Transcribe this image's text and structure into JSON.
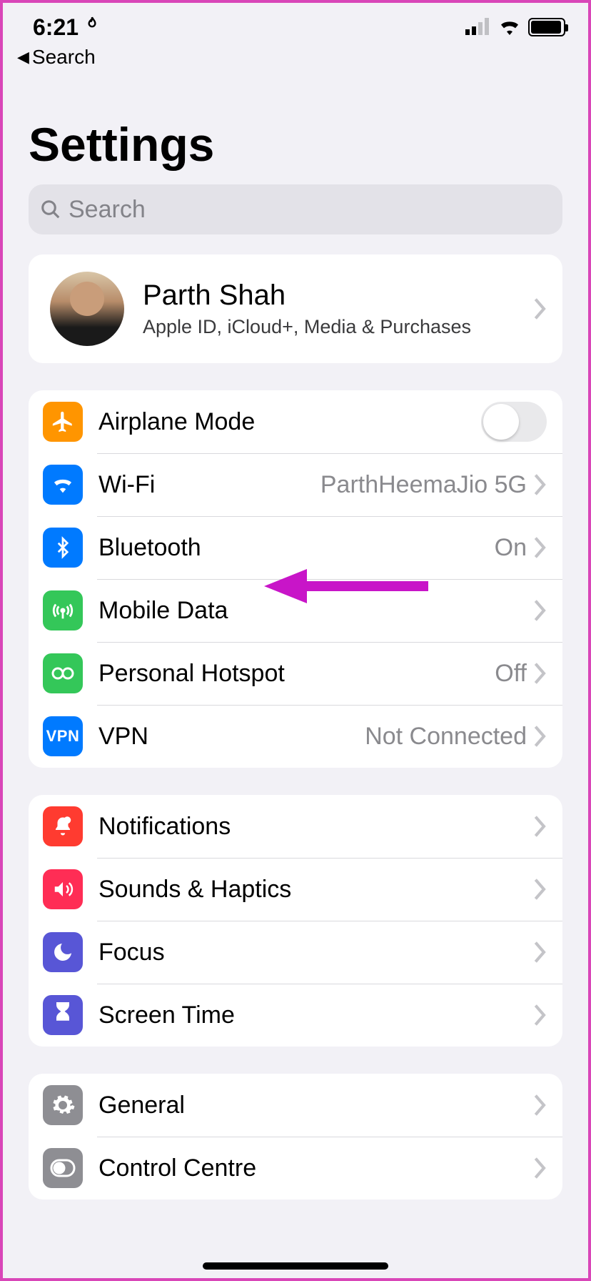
{
  "status": {
    "time": "6:21",
    "back_label": "Search"
  },
  "page_title": "Settings",
  "search": {
    "placeholder": "Search"
  },
  "profile": {
    "name": "Parth Shah",
    "subtitle": "Apple ID, iCloud+, Media & Purchases"
  },
  "network": {
    "airplane": "Airplane Mode",
    "wifi": {
      "label": "Wi-Fi",
      "value": "ParthHeemaJio 5G"
    },
    "bluetooth": {
      "label": "Bluetooth",
      "value": "On"
    },
    "mobile_data": "Mobile Data",
    "hotspot": {
      "label": "Personal Hotspot",
      "value": "Off"
    },
    "vpn": {
      "label": "VPN",
      "value": "Not Connected",
      "badge": "VPN"
    }
  },
  "alerts": {
    "notifications": "Notifications",
    "sounds": "Sounds & Haptics",
    "focus": "Focus",
    "screen_time": "Screen Time"
  },
  "general_group": {
    "general": "General",
    "control_centre": "Control Centre"
  }
}
